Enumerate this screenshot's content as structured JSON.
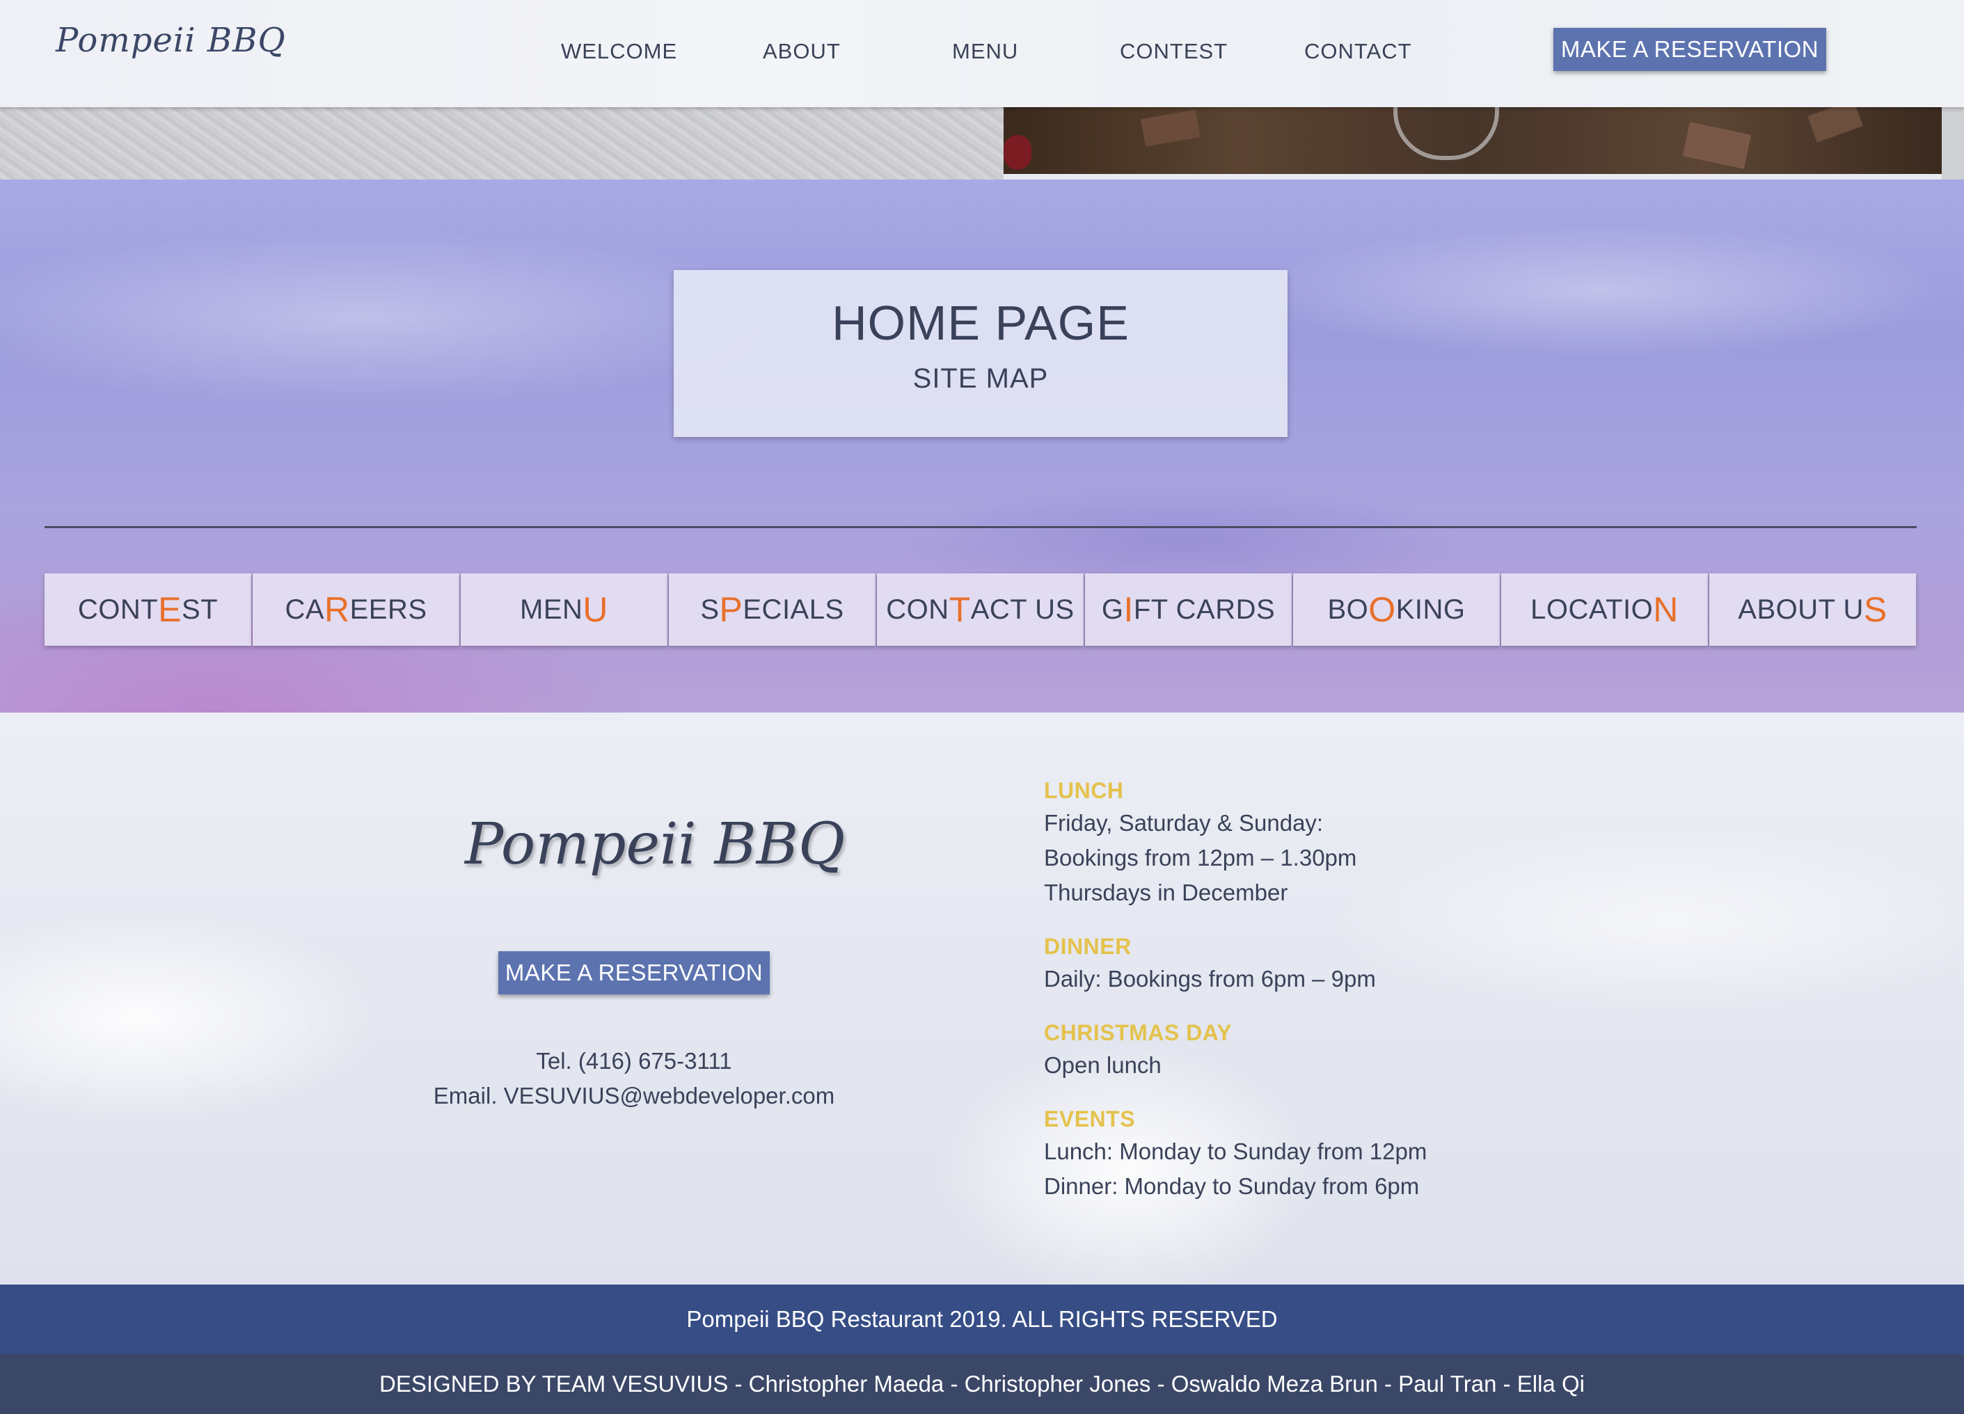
{
  "header": {
    "logo": "Pompeii BBQ",
    "nav": [
      "WELCOME",
      "ABOUT",
      "MENU",
      "CONTEST",
      "CONTACT"
    ],
    "reserve_label": "MAKE A RESERVATION"
  },
  "hero": {
    "title": "HOME PAGE",
    "subtitle": "SITE MAP"
  },
  "sitemap": [
    {
      "pre": "CONT",
      "hl": "E",
      "post": "ST"
    },
    {
      "pre": "CA",
      "hl": "R",
      "post": "EERS"
    },
    {
      "pre": "MEN",
      "hl": "U",
      "post": ""
    },
    {
      "pre": "S",
      "hl": "P",
      "post": "ECIALS"
    },
    {
      "pre": "CON",
      "hl": "T",
      "post": "ACT US"
    },
    {
      "pre": "G",
      "hl": "I",
      "post": "FT CARDS"
    },
    {
      "pre": "BO",
      "hl": "O",
      "post": "KING"
    },
    {
      "pre": "LOCATIO",
      "hl": "N",
      "post": ""
    },
    {
      "pre": "ABOUT U",
      "hl": "S",
      "post": ""
    }
  ],
  "footer": {
    "logo": "Pompeii BBQ",
    "reserve_label": "MAKE A RESERVATION",
    "tel": "Tel. (416) 675-3111",
    "email": "Email. VESUVIUS@webdeveloper.com",
    "hours": [
      {
        "label": "LUNCH",
        "lines": [
          "Friday, Saturday & Sunday:",
          "Bookings from 12pm – 1.30pm",
          "Thursdays in December"
        ]
      },
      {
        "label": "DINNER",
        "lines": [
          "Daily: Bookings from 6pm – 9pm"
        ]
      },
      {
        "label": "CHRISTMAS DAY",
        "lines": [
          "Open lunch"
        ]
      },
      {
        "label": "EVENTS",
        "lines": [
          "Lunch: Monday to Sunday from 12pm",
          "Dinner: Monday to Sunday from 6pm"
        ]
      }
    ],
    "copyright": "Pompeii BBQ Restaurant 2019. ALL RIGHTS RESERVED",
    "credits": "DESIGNED BY TEAM VESUVIUS - Christopher Maeda - Christopher Jones - Oswaldo Meza Brun - Paul Tran - Ella Qi"
  },
  "colors": {
    "accent": "#5d73b0",
    "highlight": "#e8702a",
    "label_gold": "#e4c24d",
    "copyright_bar": "#364d86",
    "credits_bar": "#3b4767"
  }
}
